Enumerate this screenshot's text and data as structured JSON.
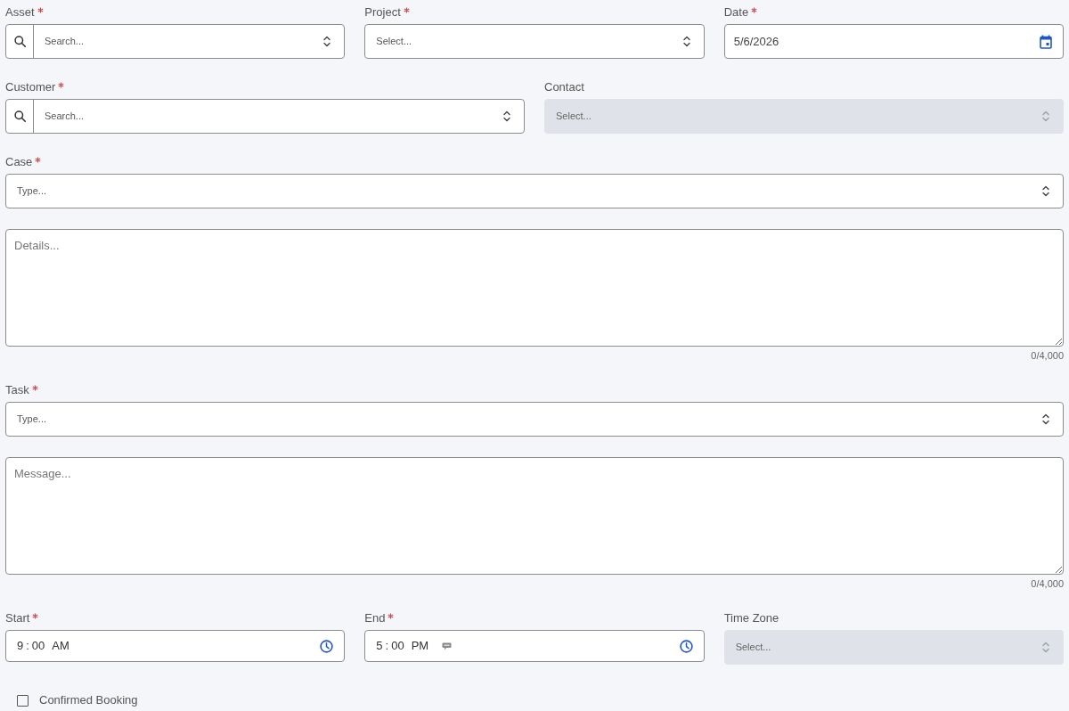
{
  "rows": [
    {
      "fields": [
        {
          "kind": "search_select",
          "label": "Asset",
          "required": true,
          "placeholder": "Search...",
          "disabled": false
        },
        {
          "kind": "select",
          "label": "Project",
          "required": true,
          "placeholder": "Select...",
          "disabled": false
        },
        {
          "kind": "date",
          "label": "Date",
          "required": true,
          "value": "5/6/2026",
          "disabled": false
        }
      ]
    },
    {
      "fields": [
        {
          "kind": "search_select",
          "label": "Customer",
          "required": true,
          "placeholder": "Search...",
          "disabled": false
        },
        {
          "kind": "select",
          "label": "Contact",
          "required": false,
          "placeholder": "Select...",
          "disabled": true
        }
      ]
    },
    {
      "fields": [
        {
          "kind": "select",
          "label": "Case",
          "required": true,
          "placeholder": "Type...",
          "disabled": false
        }
      ]
    },
    {
      "fields": [
        {
          "kind": "textarea",
          "placeholder": "Details...",
          "counter": "0/4,000"
        }
      ]
    },
    {
      "fields": [
        {
          "kind": "select",
          "label": "Task",
          "required": true,
          "placeholder": "Type...",
          "disabled": false
        }
      ]
    },
    {
      "fields": [
        {
          "kind": "textarea",
          "placeholder": "Message...",
          "counter": "0/4,000"
        }
      ]
    },
    {
      "fields": [
        {
          "kind": "time",
          "label": "Start",
          "required": true,
          "segments": [
            "9",
            ":",
            "00",
            "AM"
          ],
          "note": false,
          "disabled": false
        },
        {
          "kind": "time",
          "label": "End",
          "required": true,
          "segments": [
            "5",
            ":",
            "00",
            "PM"
          ],
          "note": true,
          "disabled": false
        },
        {
          "kind": "select",
          "label": "Time Zone",
          "required": false,
          "placeholder": "Select...",
          "disabled": true
        }
      ]
    },
    {
      "fields": [
        {
          "kind": "checkbox",
          "label": "Confirmed Booking",
          "checked": false
        }
      ]
    }
  ]
}
